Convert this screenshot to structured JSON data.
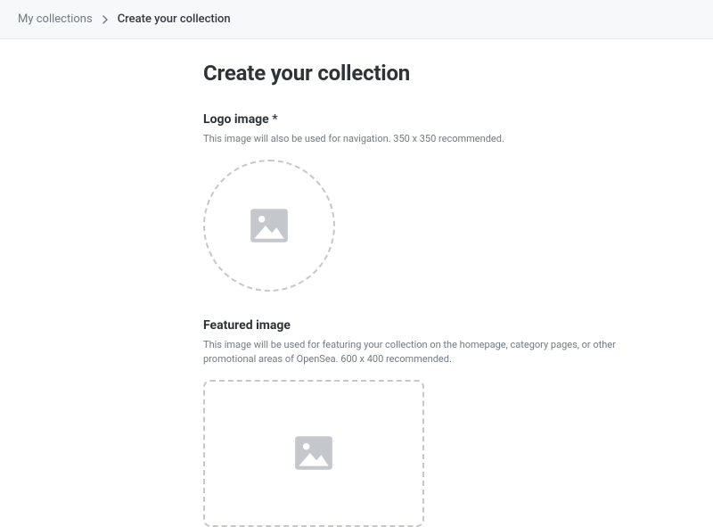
{
  "breadcrumb": {
    "parent": "My collections",
    "current": "Create your collection"
  },
  "page": {
    "title": "Create your collection"
  },
  "sections": {
    "logo": {
      "label": "Logo image",
      "required_marker": "*",
      "help": "This image will also be used for navigation. 350 x 350 recommended."
    },
    "featured": {
      "label": "Featured image",
      "help": "This image will be used for featuring your collection on the homepage, category pages, or other promotional areas of OpenSea. 600 x 400 recommended."
    }
  }
}
